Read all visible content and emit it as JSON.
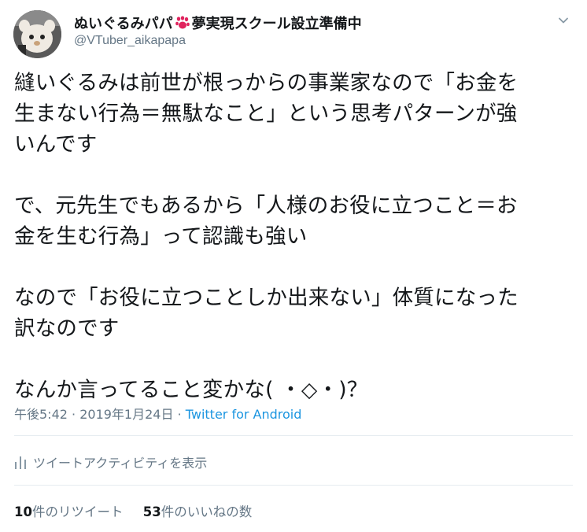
{
  "author": {
    "display_name_part1": "ぬいぐるみパパ",
    "display_name_part2": "夢実現スクール設立準備中",
    "handle": "@VTuber_aikapapa",
    "emoji_icon": "paw-prints-icon"
  },
  "tweet": {
    "text": "縫いぐるみは前世が根っからの事業家なので「お金を\n生まない行為＝無駄なこと」という思考パターンが強\nいんです\n\nで、元先生でもあるから「人様のお役に立つこと＝お\n金を生む行為」って認識も強い\n\nなので「お役に立つことしか出来ない」体質になった\n訳なのです\n\nなんか言ってること変かな( ・◇・)？"
  },
  "meta": {
    "time": "午後5:42",
    "separator1": " · ",
    "date": "2019年1月24日",
    "separator2": " · ",
    "source": "Twitter for Android"
  },
  "activity": {
    "label": "ツイートアクティビティを表示"
  },
  "stats": {
    "retweets_count": "10",
    "retweets_label": "件のリツイート",
    "likes_count": "53",
    "likes_label": "件のいいねの数"
  },
  "colors": {
    "text": "#14171a",
    "secondary": "#657786",
    "link": "#1b95e0",
    "divider": "#e6ecf0",
    "paw": "#e0245e"
  }
}
